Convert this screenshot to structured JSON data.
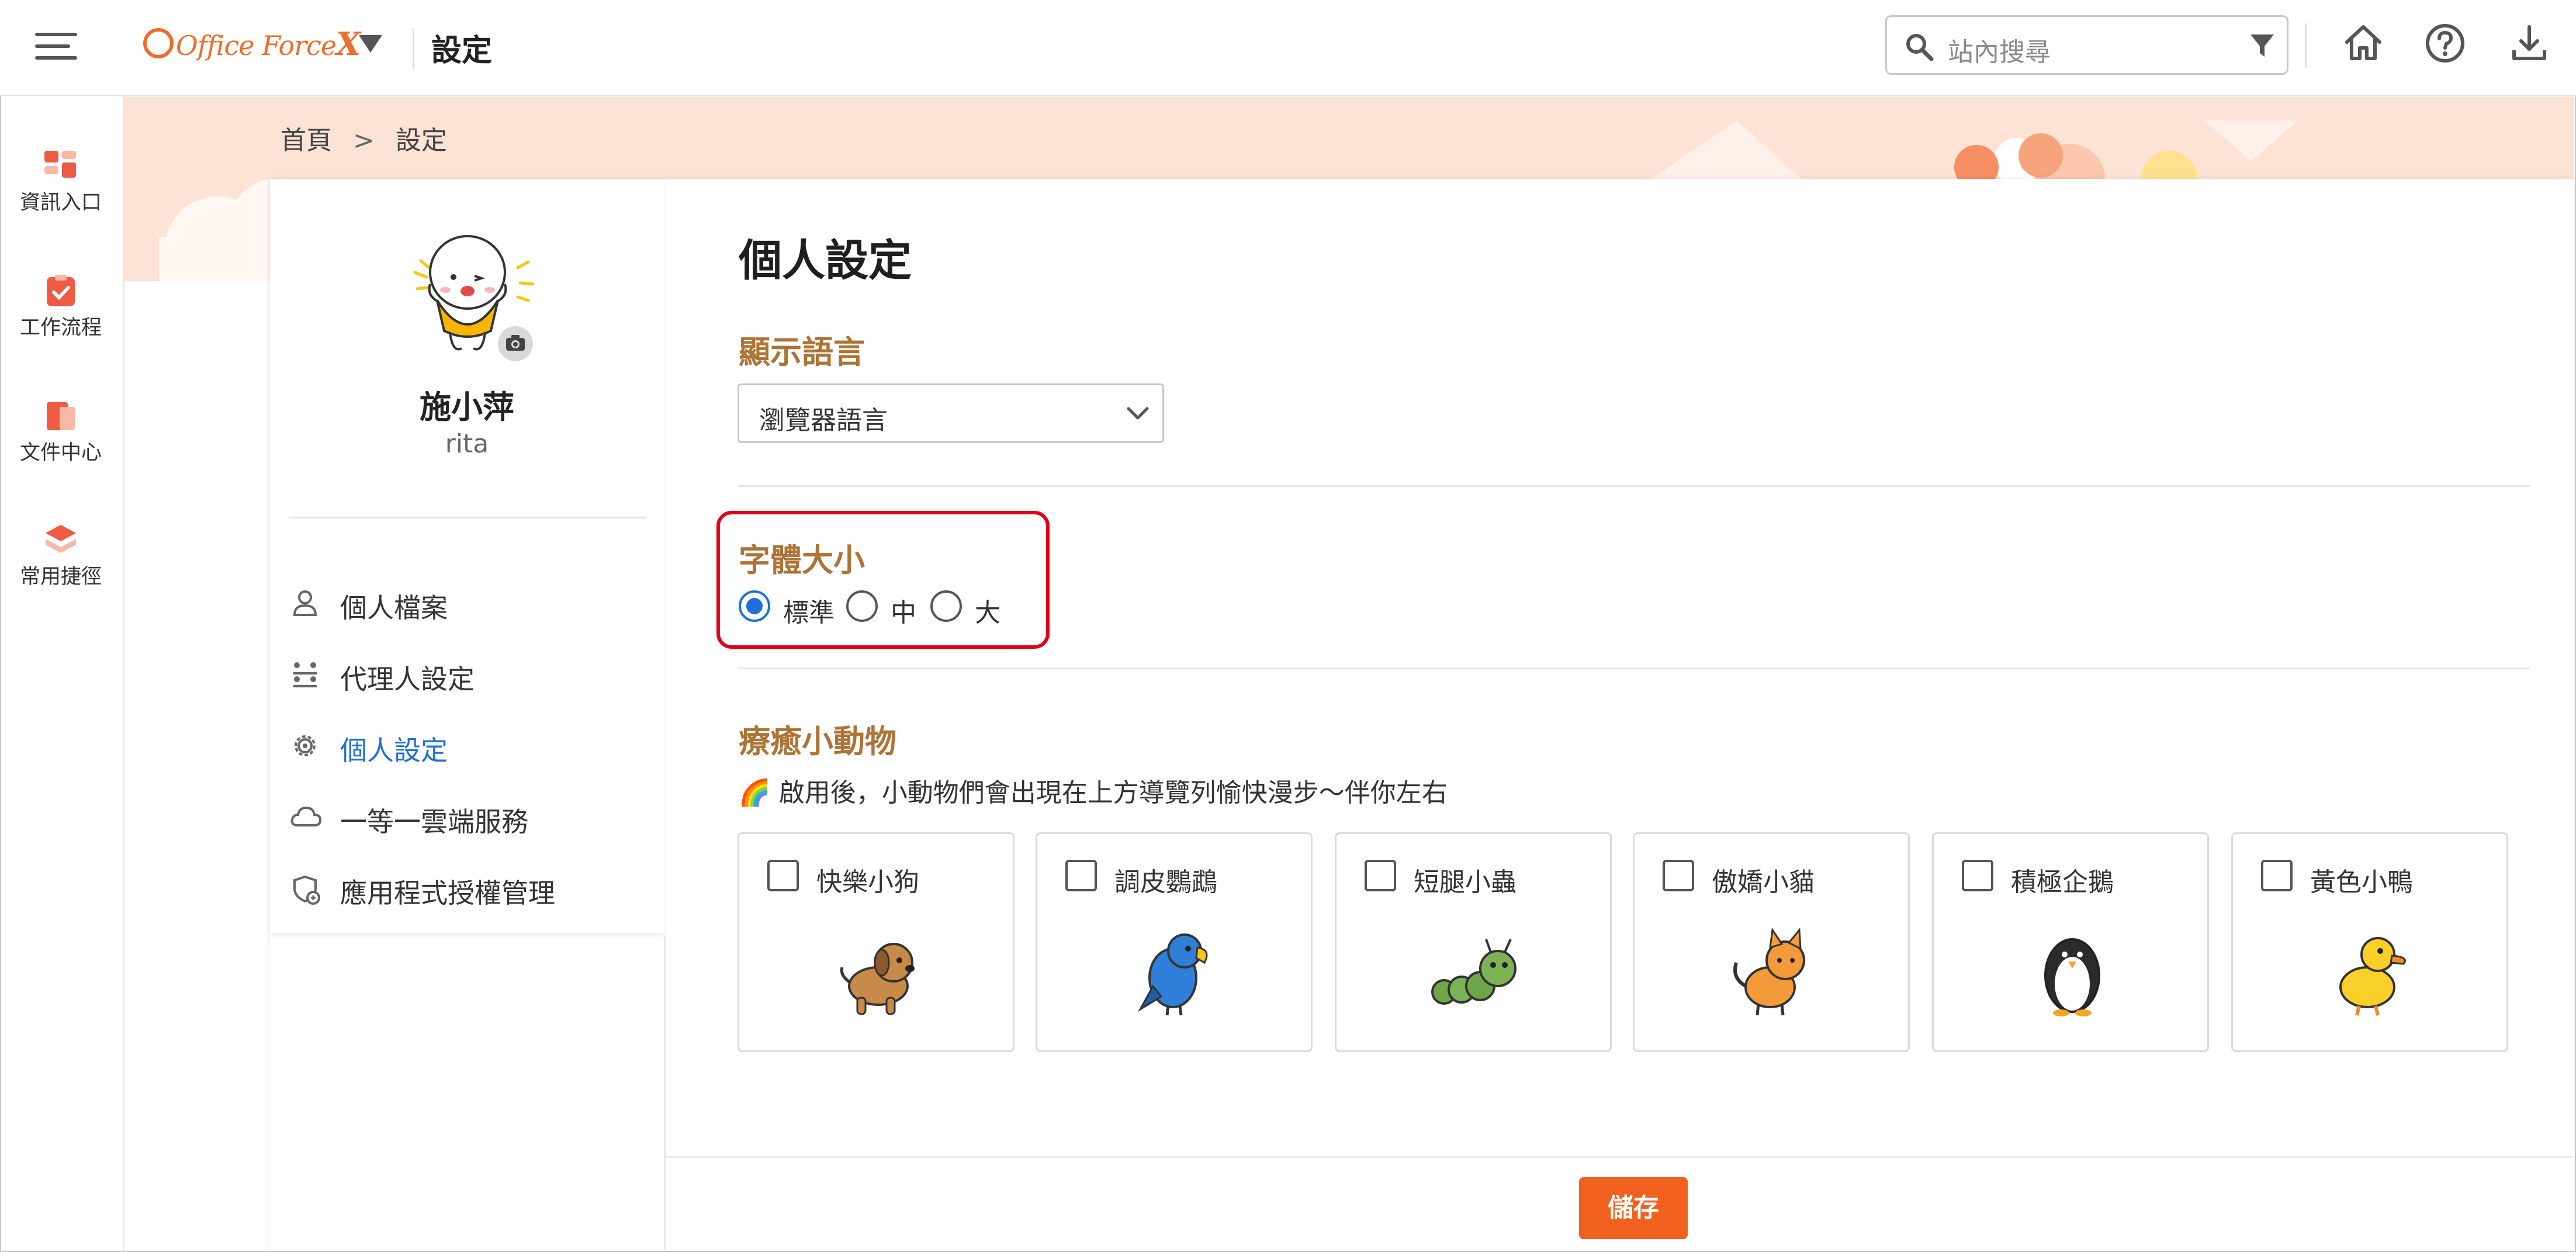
{
  "header": {
    "logo_text": "Office Force",
    "logo_x": "X",
    "page_title": "設定",
    "search_placeholder": "站內搜尋"
  },
  "sidebar": {
    "items": [
      {
        "label": "資訊入口",
        "icon": "portal-icon"
      },
      {
        "label": "工作流程",
        "icon": "workflow-icon"
      },
      {
        "label": "文件中心",
        "icon": "document-icon"
      },
      {
        "label": "常用捷徑",
        "icon": "shortcut-icon"
      }
    ]
  },
  "breadcrumb": {
    "home": "首頁",
    "separator": ">",
    "current": "設定"
  },
  "profile": {
    "name": "施小萍",
    "account": "rita"
  },
  "nav": [
    {
      "label": "個人檔案",
      "icon": "person-icon"
    },
    {
      "label": "代理人設定",
      "icon": "agent-icon"
    },
    {
      "label": "個人設定",
      "icon": "gear-icon",
      "active": true
    },
    {
      "label": "一等一雲端服務",
      "icon": "cloud-icon"
    },
    {
      "label": "應用程式授權管理",
      "icon": "app-license-icon"
    }
  ],
  "main": {
    "title": "個人設定",
    "language": {
      "title": "顯示語言",
      "value": "瀏覽器語言"
    },
    "font_size": {
      "title": "字體大小",
      "options": [
        "標準",
        "中",
        "大"
      ],
      "selected": "標準"
    },
    "pets": {
      "title": "療癒小動物",
      "description": "🌈 啟用後，小動物們會出現在上方導覽列愉快漫步～伴你左右",
      "options": [
        {
          "label": "快樂小狗",
          "checked": false
        },
        {
          "label": "調皮鸚鵡",
          "checked": false
        },
        {
          "label": "短腿小蟲",
          "checked": false
        },
        {
          "label": "傲嬌小貓",
          "checked": false
        },
        {
          "label": "積極企鵝",
          "checked": false
        },
        {
          "label": "黃色小鴨",
          "checked": false
        }
      ]
    },
    "save_label": "儲存"
  },
  "colors": {
    "accent": "#f0611f",
    "brand": "#ef6c2a",
    "link": "#1e6fd9",
    "section_title": "#ad7437",
    "highlight": "#e0001a"
  }
}
